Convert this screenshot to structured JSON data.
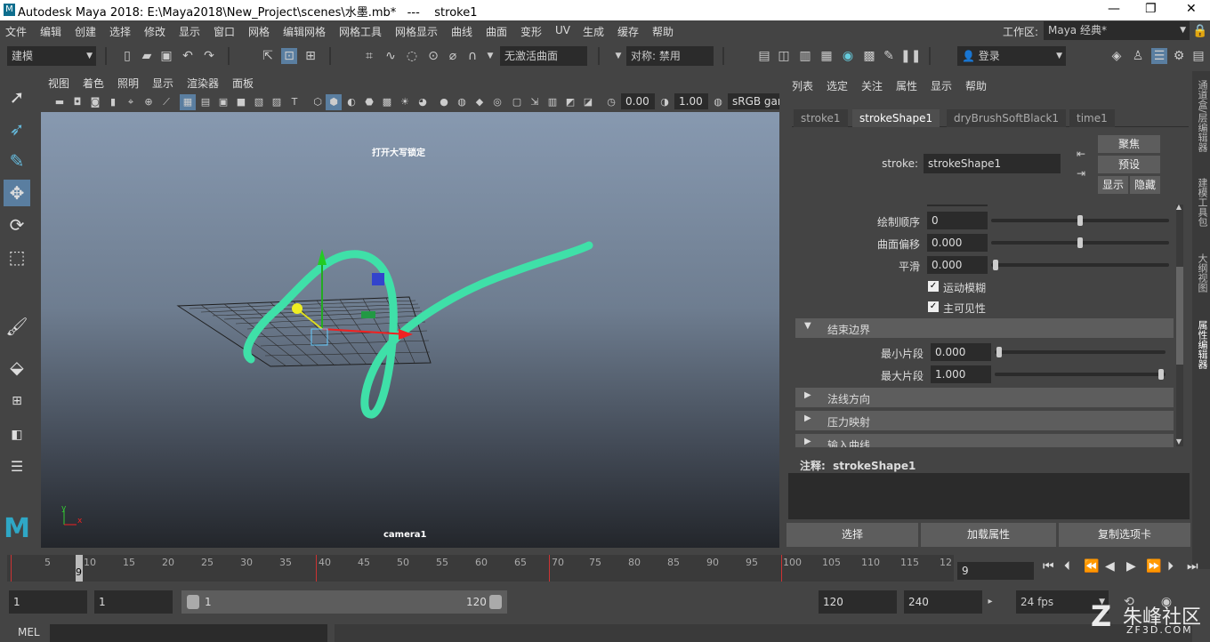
{
  "window": {
    "title": "Autodesk Maya 2018: E:\\Maya2018\\New_Project\\scenes\\水墨.mb*   ---    stroke1"
  },
  "menubar": {
    "items": [
      "文件",
      "编辑",
      "创建",
      "选择",
      "修改",
      "显示",
      "窗口",
      "网格",
      "编辑网格",
      "网格工具",
      "网格显示",
      "曲线",
      "曲面",
      "变形",
      "UV",
      "生成",
      "缓存",
      "帮助"
    ],
    "workspace_label": "工作区:",
    "workspace_value": "Maya 经典*"
  },
  "toolbar": {
    "mode": "建模",
    "live_surface": "无激活曲面",
    "symmetry": "对称: 禁用",
    "login": "登录"
  },
  "viewport": {
    "menus": [
      "视图",
      "着色",
      "照明",
      "显示",
      "渲染器",
      "面板"
    ],
    "val1": "0.00",
    "val2": "1.00",
    "colorspace": "sRGB gar",
    "hud_text": "打开大写锁定",
    "camera": "camera1",
    "axis_y": "y",
    "axis_x": "x"
  },
  "attr_editor": {
    "menus": [
      "列表",
      "选定",
      "关注",
      "属性",
      "显示",
      "帮助"
    ],
    "tabs": [
      "stroke1",
      "strokeShape1",
      "dryBrushSoftBlack1",
      "time1"
    ],
    "stroke_label": "stroke:",
    "stroke_value": "strokeShape1",
    "focus_btn": "聚焦",
    "preset_btn": "预设",
    "show_btn": "显示",
    "hide_btn": "隐藏",
    "draw_order_label": "绘制顺序",
    "draw_order_value": "0",
    "surface_offset_label": "曲面偏移",
    "surface_offset_value": "0.000",
    "smooth_label": "平滑",
    "smooth_value": "0.000",
    "motion_blur_label": "运动模糊",
    "primary_vis_label": "主可见性",
    "section_end": "结束边界",
    "min_clip_label": "最小片段",
    "min_clip_value": "0.000",
    "max_clip_label": "最大片段",
    "max_clip_value": "1.000",
    "section_normal": "法线方向",
    "section_pressure": "压力映射",
    "section_input": "输入曲线",
    "notes_label": "注释:  strokeShape1",
    "btn_select": "选择",
    "btn_load": "加载属性",
    "btn_copy": "复制选项卡"
  },
  "timeline": {
    "ticks": [
      "5",
      "10",
      "15",
      "20",
      "25",
      "30",
      "35",
      "40",
      "45",
      "50",
      "55",
      "60",
      "65",
      "70",
      "75",
      "80",
      "85",
      "90",
      "95",
      "100",
      "105",
      "110",
      "115",
      "12"
    ],
    "current": "9",
    "current_field": "9"
  },
  "range": {
    "start": "1",
    "start2": "1",
    "slider_start": "1",
    "slider_end": "120",
    "end": "120",
    "end2": "240",
    "fps": "24 fps"
  },
  "cmdline": {
    "label": "MEL"
  },
  "right_dock": [
    "通道盒/层编辑器",
    "建模工具包",
    "大纲视图",
    "属性编辑器"
  ],
  "watermark": {
    "text": "朱峰社区",
    "sub": "ZF3D.COM"
  }
}
